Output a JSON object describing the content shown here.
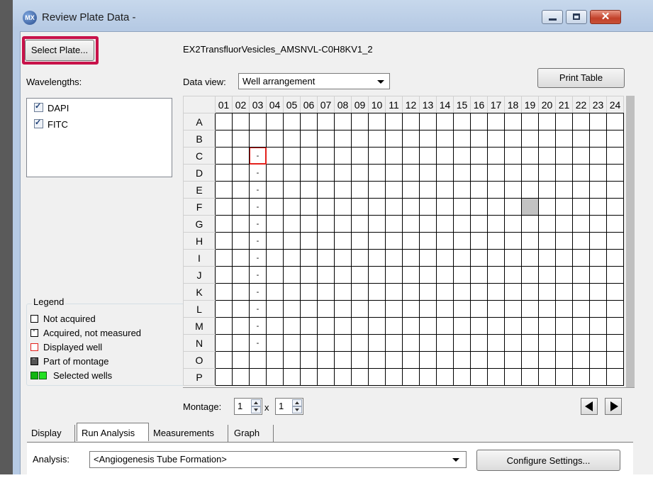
{
  "window": {
    "app_icon": "MX",
    "title": "Review Plate Data -"
  },
  "header": {
    "select_plate_label": "Select Plate...",
    "plate_name": "EX2TransfluorVesicles_AMSNVL-C0H8KV1_2"
  },
  "wavelengths": {
    "label": "Wavelengths:",
    "items": [
      {
        "label": "DAPI",
        "checked": true
      },
      {
        "label": "FITC",
        "checked": true
      }
    ]
  },
  "data_view": {
    "label": "Data view:",
    "selected": "Well arrangement"
  },
  "print_table_label": "Print Table",
  "plate": {
    "columns": [
      "01",
      "02",
      "03",
      "04",
      "05",
      "06",
      "07",
      "08",
      "09",
      "10",
      "11",
      "12",
      "13",
      "14",
      "15",
      "16",
      "17",
      "18",
      "19",
      "20",
      "21",
      "22",
      "23",
      "24"
    ],
    "rows": [
      "A",
      "B",
      "C",
      "D",
      "E",
      "F",
      "G",
      "H",
      "I",
      "J",
      "K",
      "L",
      "M",
      "N",
      "O",
      "P"
    ],
    "well_mark": "-",
    "marked_wells": [
      "C03",
      "D03",
      "E03",
      "F03",
      "G03",
      "H03",
      "I03",
      "J03",
      "K03",
      "L03",
      "M03",
      "N03"
    ],
    "displayed_well": "C03",
    "selected_wells": [
      "F19"
    ]
  },
  "legend": {
    "title": "Legend",
    "items": {
      "not_acquired": "Not acquired",
      "acquired_not_measured": "Acquired, not measured",
      "displayed_well": "Displayed well",
      "part_of_montage": "Part of montage",
      "selected_wells": "Selected wells"
    }
  },
  "montage": {
    "label": "Montage:",
    "x_value": "1",
    "times": "x",
    "y_value": "1"
  },
  "tabs": [
    {
      "label": "Display",
      "active": false
    },
    {
      "label": "Run Analysis",
      "active": true
    },
    {
      "label": "Measurements",
      "active": false
    },
    {
      "label": "Graph",
      "active": false
    }
  ],
  "analysis": {
    "label": "Analysis:",
    "selected": "<Angiogenesis Tube Formation>",
    "configure_label": "Configure Settings..."
  },
  "colors": {
    "highlight": "#c8124a",
    "displayed_border": "#e3201b",
    "selected_fill": "#c3c3c3",
    "close_button": "#c2412a"
  }
}
